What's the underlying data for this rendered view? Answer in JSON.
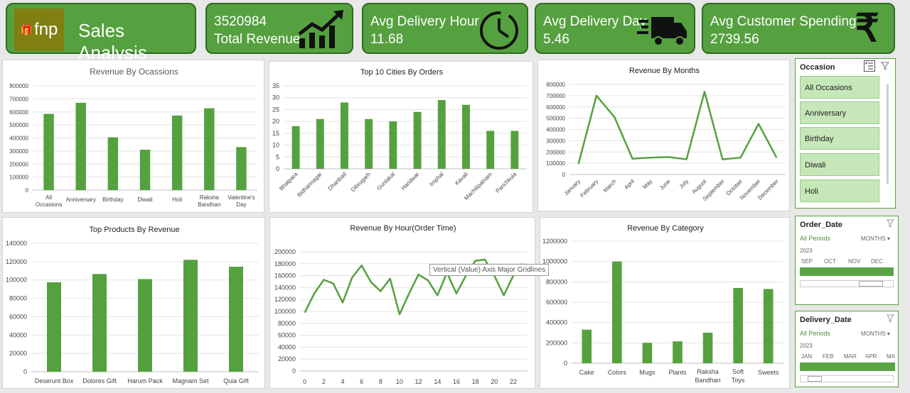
{
  "header": {
    "logo_text": "fnp",
    "title": "Sales Analysis",
    "kpis": [
      {
        "value": "3520984",
        "label": "Total Revenue",
        "icon": "trend-up-chart-icon"
      },
      {
        "label": "Avg Delivery Hour",
        "value": "11.68",
        "icon": "clock-icon"
      },
      {
        "label": "Avg Delivery Day",
        "value": "5.46",
        "icon": "delivery-truck-icon"
      },
      {
        "label": "Avg Customer Spending",
        "value": "2739.56",
        "icon": "rupee-icon"
      }
    ]
  },
  "colors": {
    "primary": "#55a13f",
    "dark": "#2e6b22",
    "bar": "#55a13f",
    "tile": "#c6e7b8"
  },
  "chart_data": [
    {
      "type": "bar",
      "title": "Revenue By Ocassions",
      "categories": [
        "All Occasions",
        "Anniversary",
        "Birthday",
        "Diwali",
        "Holi",
        "Raksha Bandhan",
        "Valentine's Day"
      ],
      "values": [
        585000,
        670000,
        405000,
        310000,
        572000,
        628000,
        330000
      ],
      "ylim": [
        0,
        800000
      ],
      "yticks": [
        0,
        100000,
        200000,
        300000,
        400000,
        500000,
        600000,
        700000,
        800000
      ],
      "grid": true
    },
    {
      "type": "bar",
      "title": "Top 10 Cities   By Orders",
      "categories": [
        "Bhatpara",
        "Bidhannagar",
        "Dhanbad",
        "Dibrugarh",
        "Guntakal",
        "Haridwar",
        "Imphal",
        "Kavali",
        "Machilipatnam",
        "Panchkula"
      ],
      "values": [
        18,
        21,
        28,
        21,
        20,
        24,
        29,
        27,
        16,
        16
      ],
      "ylim": [
        0,
        35
      ],
      "yticks": [
        0,
        5,
        10,
        15,
        20,
        25,
        30,
        35
      ],
      "grid": true
    },
    {
      "type": "line",
      "title": "Revenue By Months",
      "categories": [
        "January",
        "February",
        "March",
        "April",
        "May",
        "June",
        "July",
        "August",
        "September",
        "October",
        "November",
        "December"
      ],
      "values": [
        95000,
        700000,
        510000,
        140000,
        150000,
        155000,
        135000,
        735000,
        135000,
        150000,
        450000,
        150000
      ],
      "ylim": [
        0,
        800000
      ],
      "yticks": [
        0,
        100000,
        200000,
        300000,
        400000,
        500000,
        600000,
        700000,
        800000
      ],
      "grid": true
    },
    {
      "type": "bar",
      "title": "Top  Products By Revenue",
      "categories": [
        "Deserunt Box",
        "Dolores Gift",
        "Harum Pack",
        "Magnam Set",
        "Quia Gift"
      ],
      "values": [
        97500,
        106500,
        101000,
        122000,
        114500
      ],
      "ylim": [
        0,
        140000
      ],
      "yticks": [
        0,
        20000,
        40000,
        60000,
        80000,
        100000,
        120000,
        140000
      ],
      "grid": true
    },
    {
      "type": "line",
      "title": "Revenue By Hour(Order Time)",
      "x": [
        0,
        1,
        2,
        3,
        4,
        5,
        6,
        7,
        8,
        9,
        10,
        11,
        12,
        13,
        14,
        15,
        16,
        17,
        18,
        19,
        20,
        21,
        22,
        23
      ],
      "values": [
        98000,
        130000,
        153000,
        147000,
        115000,
        157000,
        177000,
        149000,
        134000,
        155000,
        95000,
        130000,
        162000,
        152000,
        127000,
        165000,
        130000,
        160000,
        185000,
        187000,
        160000,
        127000,
        160000,
        180000
      ],
      "xticks": [
        0,
        2,
        4,
        6,
        8,
        10,
        12,
        14,
        16,
        18,
        20,
        22
      ],
      "ylim": [
        0,
        200000
      ],
      "yticks": [
        0,
        20000,
        40000,
        60000,
        80000,
        100000,
        120000,
        140000,
        160000,
        180000,
        200000
      ],
      "grid": true,
      "tooltip": "Vertical (Value) Axis Major Gridlines"
    },
    {
      "type": "bar",
      "title": "Revenue By Category",
      "categories": [
        "Cake",
        "Colors",
        "Mugs",
        "Plants",
        "Raksha Bandhan",
        "Soft Toys",
        "Sweets"
      ],
      "values": [
        330000,
        1000000,
        200000,
        215000,
        300000,
        740000,
        730000
      ],
      "ylim": [
        0,
        1200000
      ],
      "yticks": [
        0,
        200000,
        400000,
        600000,
        800000,
        1000000,
        1200000
      ],
      "grid": true
    }
  ],
  "slicers": {
    "occasion": {
      "title": "Occasion",
      "items": [
        "All Occasions",
        "Anniversary",
        "Birthday",
        "Diwali",
        "Holi"
      ],
      "icons": [
        "multi-select-icon",
        "clear-filter-icon"
      ]
    },
    "order_date": {
      "title": "Order_Date",
      "range": "All Periods",
      "level": "MONTHS",
      "year": "2023",
      "months": [
        "SEP",
        "OCT",
        "NOV",
        "DEC"
      ]
    },
    "delivery_date": {
      "title": "Delivery_Date",
      "range": "All Periods",
      "level": "MONTHS",
      "year": "2023",
      "months": [
        "JAN",
        "FEB",
        "MAR",
        "APR",
        "MA"
      ]
    }
  }
}
